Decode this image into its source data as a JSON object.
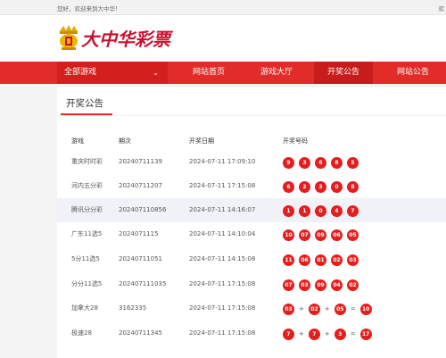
{
  "topbar": {
    "welcome": "您好，欢迎来到大中华！",
    "right_text": "欢"
  },
  "logo": {
    "text": "大中华彩票"
  },
  "nav": {
    "all_games": "全部游戏",
    "items": [
      "网站首页",
      "游戏大厅",
      "开奖公告",
      "网站公告"
    ],
    "active_index": 2
  },
  "panel": {
    "title": "开奖公告",
    "columns": [
      "游戏",
      "期次",
      "开奖日期",
      "开奖号码"
    ],
    "rows": [
      {
        "game": "重庆时时彩",
        "issue": "20240711139",
        "date": "2024-07-11 17:09:10",
        "numbers": [
          "9",
          "3",
          "6",
          "8",
          "5"
        ],
        "ops": []
      },
      {
        "game": "河内五分彩",
        "issue": "20240711207",
        "date": "2024-07-11 17:15:08",
        "numbers": [
          "6",
          "2",
          "3",
          "0",
          "8"
        ],
        "ops": []
      },
      {
        "game": "腾讯分分彩",
        "issue": "202407110856",
        "date": "2024-07-11 14:16:07",
        "numbers": [
          "1",
          "1",
          "0",
          "4",
          "7"
        ],
        "ops": []
      },
      {
        "game": "广东11选5",
        "issue": "2024071115",
        "date": "2024-07-11 14:10:04",
        "numbers": [
          "10",
          "07",
          "09",
          "06",
          "05"
        ],
        "ops": []
      },
      {
        "game": "5分11选5",
        "issue": "20240711051",
        "date": "2024-07-11 14:15:08",
        "numbers": [
          "11",
          "06",
          "01",
          "02",
          "03"
        ],
        "ops": []
      },
      {
        "game": "分分11选5",
        "issue": "202407111035",
        "date": "2024-07-11 17:15:08",
        "numbers": [
          "07",
          "03",
          "09",
          "04",
          "02"
        ],
        "ops": []
      },
      {
        "game": "加拿大28",
        "issue": "3162335",
        "date": "2024-07-11 17:15:08",
        "numbers": [
          "03",
          "02",
          "05",
          "10"
        ],
        "ops": [
          "+",
          "+",
          "="
        ]
      },
      {
        "game": "极速28",
        "issue": "20240711345",
        "date": "2024-07-11 17:15:08",
        "numbers": [
          "7",
          "7",
          "3",
          "17"
        ],
        "ops": [
          "+",
          "+",
          "="
        ]
      }
    ]
  },
  "colors": {
    "brand_red": "#e22c29",
    "ball_red": "#e51d1d",
    "highlight_row": "#f0f2f7"
  }
}
